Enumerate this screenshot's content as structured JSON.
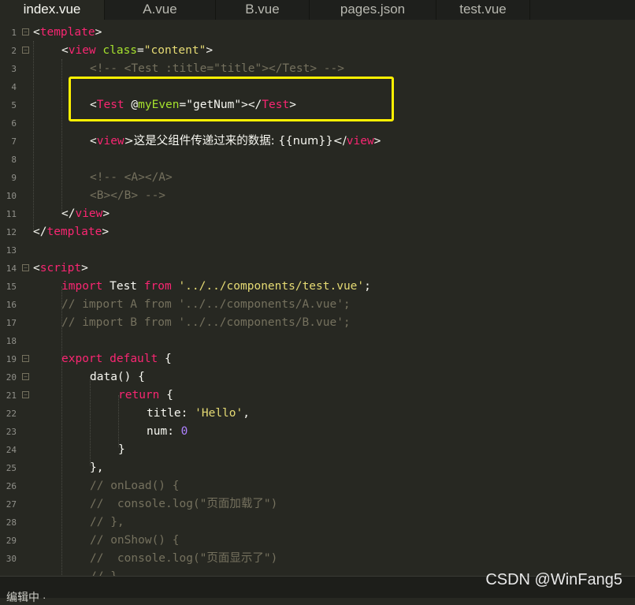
{
  "tabs": [
    {
      "label": "index.vue"
    },
    {
      "label": "A.vue"
    },
    {
      "label": "B.vue"
    },
    {
      "label": "pages.json"
    },
    {
      "label": "test.vue"
    }
  ],
  "lines": {
    "n1": "1",
    "n2": "2",
    "n3": "3",
    "n4": "4",
    "n5": "5",
    "n6": "6",
    "n7": "7",
    "n8": "8",
    "n9": "9",
    "n10": "10",
    "n11": "11",
    "n12": "12",
    "n13": "13",
    "n14": "14",
    "n15": "15",
    "n16": "16",
    "n17": "17",
    "n18": "18",
    "n19": "19",
    "n20": "20",
    "n21": "21",
    "n22": "22",
    "n23": "23",
    "n24": "24",
    "n25": "25",
    "n26": "26",
    "n27": "27",
    "n28": "28",
    "n29": "29",
    "n30": "30"
  },
  "code": {
    "l1": {
      "a": "<",
      "b": "template",
      "c": ">"
    },
    "l2": {
      "a": "<",
      "b": "view",
      "c": " ",
      "d": "class",
      "e": "=",
      "f": "\"content\"",
      "g": ">"
    },
    "l3": "<!-- <Test :title=\"title\"></Test> -->",
    "l5": {
      "a": "<",
      "b": "Test",
      "c": " @",
      "d": "myEven",
      "e": "=",
      "f": "\"getNum\"",
      "g": "></",
      "h": "Test",
      "i": ">"
    },
    "l7": {
      "a": "<",
      "b": "view",
      "c": ">这是父组件传递过来的数据: {{num}}</",
      "d": "view",
      "e": ">"
    },
    "l9": "<!-- <A></A>",
    "l10": "<B></B> -->",
    "l11": {
      "a": "</",
      "b": "view",
      "c": ">"
    },
    "l12": {
      "a": "</",
      "b": "template",
      "c": ">"
    },
    "l14": {
      "a": "<",
      "b": "script",
      "c": ">"
    },
    "l15": {
      "a": "import",
      "b": " Test ",
      "c": "from",
      "d": " ",
      "e": "'../../components/test.vue'",
      "f": ";"
    },
    "l16": "// import A from '../../components/A.vue';",
    "l17": "// import B from '../../components/B.vue';",
    "l19": {
      "a": "export",
      "b": " ",
      "c": "default",
      "d": " {"
    },
    "l20": "data() {",
    "l21": "return",
    "l21b": " {",
    "l22": {
      "a": "title",
      "b": ": ",
      "c": "'Hello'",
      "d": ","
    },
    "l23": {
      "a": "num",
      "b": ": ",
      "c": "0"
    },
    "l24": "}",
    "l25": "},",
    "l26": "// onLoad() {",
    "l27": "//  console.log(\"页面加载了\")",
    "l28": "// },",
    "l29": "// onShow() {",
    "l30": "//  console.log(\"页面显示了\")",
    "l31": "// },"
  },
  "bottom_text": "编辑中 ·",
  "watermark": "CSDN @WinFang5",
  "colors": {
    "background": "#272822",
    "tag": "#f92672",
    "attr": "#a6e22e",
    "string": "#e6db74",
    "comment": "#75715e",
    "number": "#ae81ff",
    "highlight": "#fff000"
  }
}
